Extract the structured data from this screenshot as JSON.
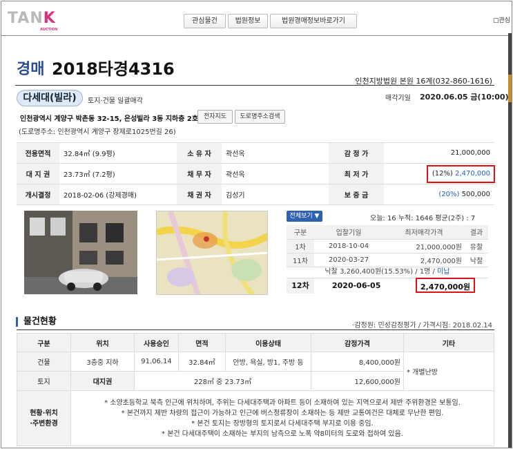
{
  "logo": {
    "text_main": "TAN",
    "text_arrow": "K",
    "text_sub": "AUCTION"
  },
  "nav": {
    "items": [
      "관심물건",
      "법원정보",
      "법원경매정보바로가기"
    ]
  },
  "header_checkbox": "□관심",
  "case": {
    "kind": "경매",
    "number": "2018타경4316",
    "court": "인천지방법원 본원 16계(032-860-1616)"
  },
  "summary": {
    "badge": "다세대(빌라)",
    "sale_type": "토지·건물 일괄매각",
    "sale_date_label": "매각기일",
    "sale_date": "2020.06.05 금(10:00)",
    "address": "인천광역시 계양구 박촌동 32-15, 은성빌라 3동 지하층 2호",
    "map_button": "전자지도",
    "road_search_button": "도로명주소검색",
    "road_address": "(도로명주소: 인천광역시 계양구 장제로1025번길 26)"
  },
  "info": {
    "exclusive_area_label": "전용면적",
    "exclusive_area": "32.84㎡ (9.9평)",
    "owner_label": "소 유 자",
    "owner": "곽선옥",
    "appraisal_label": "감 정 가",
    "appraisal": "21,000,000",
    "land_right_label": "대 지 권",
    "land_right": "23.73㎡ (7.2평)",
    "debtor_label": "채 무 자",
    "debtor": "곽선옥",
    "min_price_label": "최 저 가",
    "min_price_pct": "(12%)",
    "min_price": "2,470,000",
    "start_label": "개시결정",
    "start": "2018-02-06 (강제경매)",
    "creditor_label": "채 권 자",
    "creditor": "김성기",
    "deposit_label": "보 증 금",
    "deposit_pct": "(20%)",
    "deposit": "500,000"
  },
  "history": {
    "view_all": "전체보기 ▼",
    "stats": "오늘:  16    누적:  1646    평균(2주) :  7",
    "headers": [
      "구분",
      "입찰기일",
      "최저매각가격",
      "결과"
    ],
    "rows": [
      {
        "round": "1차",
        "date": "2018-10-04",
        "price": "21,000,000원",
        "result": "유찰"
      },
      {
        "round": "11차",
        "date": "2020-03-27",
        "price": "2,470,000원",
        "result": "낙찰"
      }
    ],
    "winbid_text": "낙찰 3,260,400원(15.53%) / 1명 / ",
    "winbid_status": "미납",
    "current": {
      "round": "12차",
      "date": "2020-06-05",
      "price": "2,470,000원"
    }
  },
  "property": {
    "section_title": "물건현황",
    "meta": "·감정원: 민성감정평가 / 가격시점: 2018.02.14",
    "headers": [
      "구분",
      "위치",
      "사용승인",
      "면적",
      "이용상태",
      "감정가격",
      "기타"
    ],
    "building": {
      "type": "건물",
      "location": "3층중 지하",
      "approval": "91.06.14",
      "area": "32.84㎡",
      "use": "안방, 욕실, 방1, 주방 등",
      "price": "8,400,000원"
    },
    "land": {
      "type": "토지",
      "location": "대지권",
      "area": "228㎡ 중 23.73㎡",
      "price": "12,600,000원"
    },
    "etc": "* 개별난방",
    "env_label": "현황·위치\n·주변환경",
    "notes": [
      "* 소양초등학교 북측 인근에 위치하며, 주위는 다세대주택과 아파트 등이 소재하여 있는 지역으로서 제반 주위환경은 보통임.",
      "* 본건까지 제반 차량의 접근이 가능하고 인근에 버스정류장이 소재하는 등 제반 교통여건은 대체로 무난한 편임.",
      "* 본건 토지는 장방형의 토지로서 다세대주택 부지로 이용 중임.",
      "* 본건 다세대주택이 소재하는 부지의 남측으로 노폭 약8미터의 도로와 접하여 있음."
    ]
  },
  "colors": {
    "accent": "#2f61b0",
    "highlight": "#e01010",
    "link": "#2060c0"
  }
}
